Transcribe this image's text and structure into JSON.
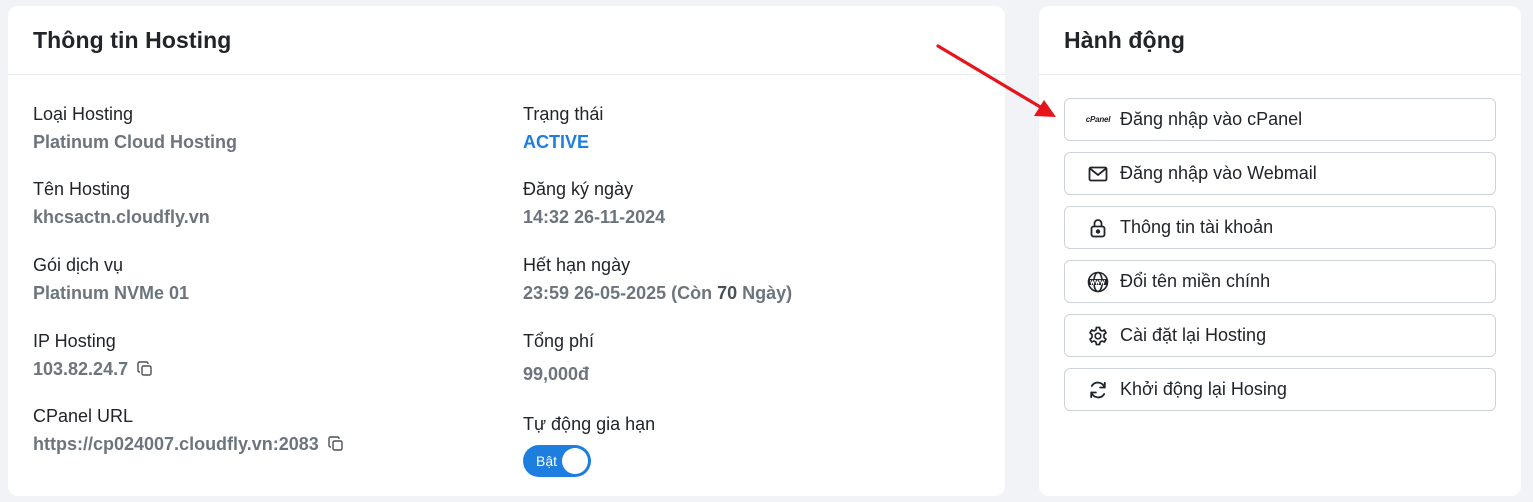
{
  "info": {
    "title": "Thông tin Hosting",
    "left": [
      {
        "label": "Loại Hosting",
        "value": "Platinum Cloud Hosting"
      },
      {
        "label": "Tên Hosting",
        "value": "khcsactn.cloudfly.vn"
      },
      {
        "label": "Gói dịch vụ",
        "value": "Platinum NVMe 01"
      },
      {
        "label": "IP Hosting",
        "value": "103.82.24.7"
      },
      {
        "label": "CPanel URL",
        "value": "https://cp024007.cloudfly.vn:2083"
      }
    ],
    "right": {
      "status_label": "Trạng thái",
      "status_value": "ACTIVE",
      "registered_label": "Đăng ký ngày",
      "registered_value": "14:32 26-11-2024",
      "expiry_label": "Hết hạn ngày",
      "expiry_value": "23:59 26-05-2025",
      "remaining_prefix": "(Còn",
      "remaining_days": "70",
      "remaining_suffix": "Ngày)",
      "total_label": "Tổng phí",
      "total_value": "99,000đ",
      "autorenew_label": "Tự động gia hạn",
      "autorenew_toggle": "Bật"
    }
  },
  "actions": {
    "title": "Hành động",
    "cpanel_logo_text": "cPanel",
    "buttons": [
      {
        "label": "Đăng nhập vào cPanel",
        "icon": "cpanel-icon"
      },
      {
        "label": "Đăng nhập vào Webmail",
        "icon": "mail-icon"
      },
      {
        "label": "Thông tin tài khoản",
        "icon": "lock-icon"
      },
      {
        "label": "Đổi tên miền chính",
        "icon": "www-globe-icon"
      },
      {
        "label": "Cài đặt lại Hosting",
        "icon": "gear-icon"
      },
      {
        "label": "Khởi động lại Hosing",
        "icon": "refresh-icon"
      }
    ]
  },
  "colors": {
    "accent": "#1e7ee0",
    "arrow": "#e8141b",
    "muted_text": "#6c757d"
  }
}
